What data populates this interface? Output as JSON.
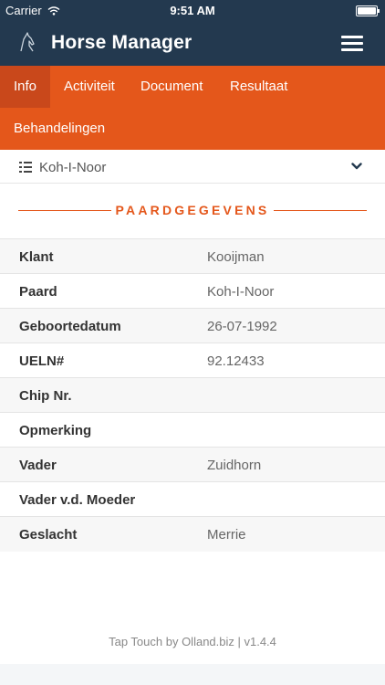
{
  "status_bar": {
    "carrier": "Carrier",
    "time": "9:51 AM"
  },
  "header": {
    "title": "Horse Manager"
  },
  "tabs": [
    {
      "label": "Info"
    },
    {
      "label": "Activiteit"
    },
    {
      "label": "Document"
    },
    {
      "label": "Resultaat"
    },
    {
      "label": "Behandelingen"
    }
  ],
  "horse_selector": {
    "selected": "Koh-I-Noor"
  },
  "section": {
    "heading": "PAARDGEGEVENS"
  },
  "fields": [
    {
      "label": "Klant",
      "value": "Kooijman"
    },
    {
      "label": "Paard",
      "value": "Koh-I-Noor"
    },
    {
      "label": "Geboortedatum",
      "value": "26-07-1992"
    },
    {
      "label": "UELN#",
      "value": "92.12433"
    },
    {
      "label": "Chip Nr.",
      "value": ""
    },
    {
      "label": "Opmerking",
      "value": ""
    },
    {
      "label": "Vader",
      "value": "Zuidhorn"
    },
    {
      "label": "Vader v.d. Moeder",
      "value": ""
    },
    {
      "label": "Geslacht",
      "value": "Merrie"
    }
  ],
  "footer": {
    "text": "Tap Touch by Olland.biz | v1.4.4"
  },
  "colors": {
    "nav": "#23394f",
    "accent": "#e4571b",
    "active_tab": "#c9481b"
  }
}
